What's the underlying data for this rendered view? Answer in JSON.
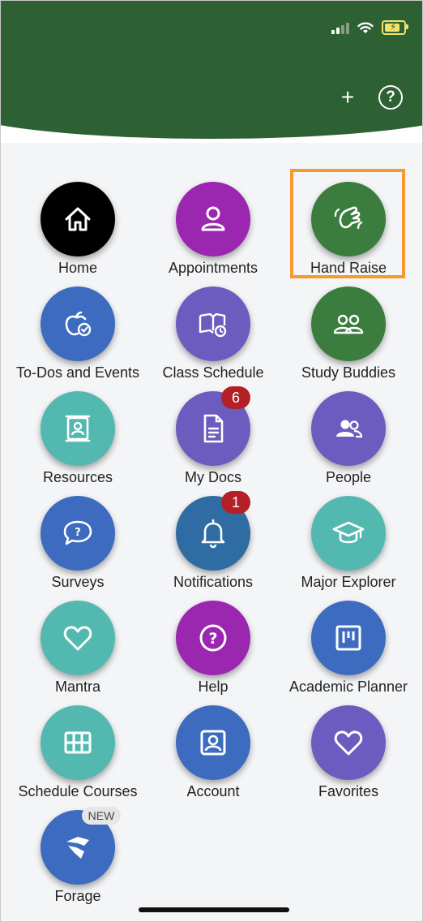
{
  "header": {
    "add_label": "+",
    "help_label": "?"
  },
  "tiles": [
    {
      "label": "Home",
      "icon": "home-icon",
      "color": "#000000"
    },
    {
      "label": "Appointments",
      "icon": "person-icon",
      "color": "#9b27b0"
    },
    {
      "label": "Hand Raise",
      "icon": "hand-raise-icon",
      "color": "#3a7d3f"
    },
    {
      "label": "To-Dos and Events",
      "icon": "apple-check-icon",
      "color": "#3d6bbf"
    },
    {
      "label": "Class Schedule",
      "icon": "book-watch-icon",
      "color": "#6c5cbf"
    },
    {
      "label": "Study Buddies",
      "icon": "study-buddies-icon",
      "color": "#3a7d3f"
    },
    {
      "label": "Resources",
      "icon": "contact-card-icon",
      "color": "#53b9b0"
    },
    {
      "label": "My Docs",
      "icon": "document-icon",
      "color": "#6c5cbf"
    },
    {
      "label": "People",
      "icon": "people-icon",
      "color": "#6c5cbf"
    },
    {
      "label": "Surveys",
      "icon": "speech-question-icon",
      "color": "#3d6bbf"
    },
    {
      "label": "Notifications",
      "icon": "bell-icon",
      "color": "#2f6ca3"
    },
    {
      "label": "Major Explorer",
      "icon": "graduation-cap-icon",
      "color": "#53b9b0"
    },
    {
      "label": "Mantra",
      "icon": "heart-icon",
      "color": "#53b9b0"
    },
    {
      "label": "Help",
      "icon": "help-circle-icon",
      "color": "#9b27b0"
    },
    {
      "label": "Academic Planner",
      "icon": "planner-board-icon",
      "color": "#3d6bbf"
    },
    {
      "label": "Schedule Courses",
      "icon": "grid-calendar-icon",
      "color": "#53b9b0"
    },
    {
      "label": "Account",
      "icon": "account-card-icon",
      "color": "#3d6bbf"
    },
    {
      "label": "Favorites",
      "icon": "heart-icon",
      "color": "#6c5cbf"
    },
    {
      "label": "Forage",
      "icon": "forage-logo-icon",
      "color": "#3d6bbf"
    }
  ],
  "badges": {
    "my_docs_count": "6",
    "notifications_count": "1",
    "forage_new": "NEW"
  },
  "colors": {
    "header_green": "#2d6133",
    "highlight": "#f39a32",
    "badge_red": "#b32025"
  }
}
